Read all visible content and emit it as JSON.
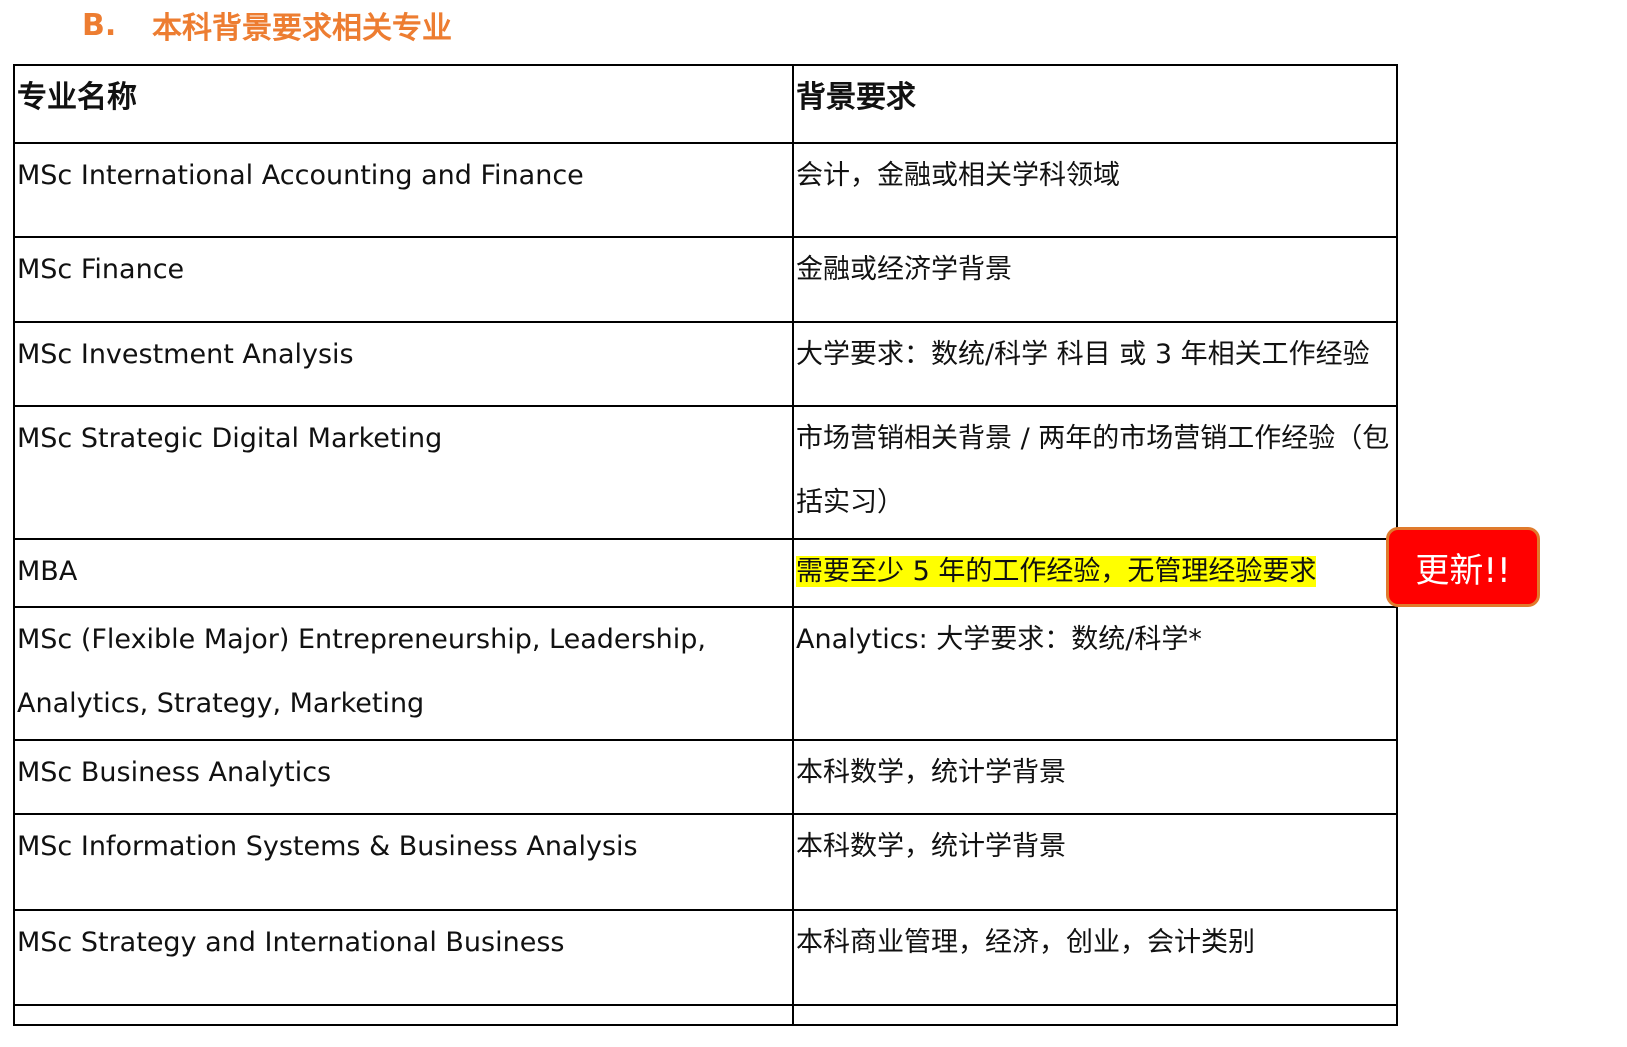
{
  "heading": {
    "letter": "B.",
    "title": "本科背景要求相关专业"
  },
  "table": {
    "columns": [
      "专业名称",
      "背景要求"
    ],
    "rows": [
      {
        "program": "MSc International Accounting and Finance",
        "requirement": "会计，金融或相关学科领域"
      },
      {
        "program": "MSc Finance",
        "requirement": "金融或经济学背景"
      },
      {
        "program": "MSc Investment Analysis",
        "requirement": "大学要求：数统/科学 科目 或 3 年相关工作经验"
      },
      {
        "program": "MSc Strategic Digital Marketing",
        "requirement": "市场营销相关背景 / 两年的市场营销工作经验（包括实习）"
      },
      {
        "program": "MBA",
        "requirement": "需要至少 5 年的工作经验，无管理经验要求"
      },
      {
        "program": "MSc (Flexible Major) Entrepreneurship, Leadership, Analytics, Strategy, Marketing",
        "requirement": "Analytics: 大学要求：数统/科学*"
      },
      {
        "program": "MSc Business Analytics",
        "requirement": "本科数学，统计学背景"
      },
      {
        "program": "MSc Information Systems & Business Analysis",
        "requirement": "本科数学，统计学背景"
      },
      {
        "program": "MSc Strategy and International Business",
        "requirement": "本科商业管理，经济，创业，会计类别"
      }
    ]
  },
  "badge": {
    "label": "更新!!",
    "color": "#ff0000"
  },
  "colors": {
    "heading": "#ed7d31",
    "highlight": "#ffff00"
  }
}
